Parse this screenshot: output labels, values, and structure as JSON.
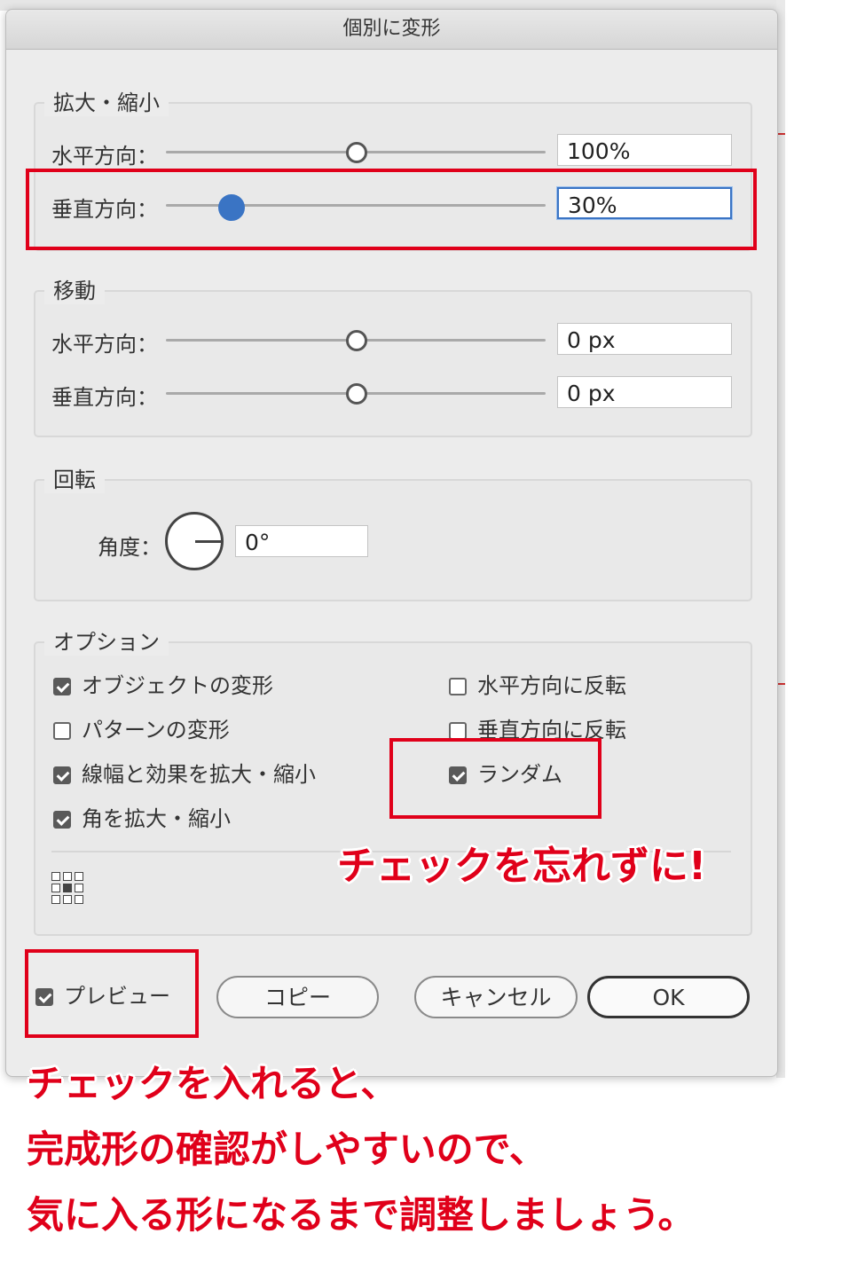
{
  "dialog": {
    "title": "個別に変形",
    "scale": {
      "legend": "拡大・縮小",
      "horizontal": {
        "label": "水平方向：",
        "value": "100%",
        "slider_level": 0.5
      },
      "vertical": {
        "label": "垂直方向：",
        "value": "30%",
        "slider_level": 0.17
      }
    },
    "move": {
      "legend": "移動",
      "horizontal": {
        "label": "水平方向：",
        "value": "0 px",
        "slider_level": 0.5
      },
      "vertical": {
        "label": "垂直方向：",
        "value": "0 px",
        "slider_level": 0.5
      }
    },
    "rotate": {
      "legend": "回転",
      "angle_label": "角度：",
      "angle_value": "0°"
    },
    "options": {
      "legend": "オプション",
      "left": [
        {
          "label": "オブジェクトの変形",
          "checked": true
        },
        {
          "label": "パターンの変形",
          "checked": false
        },
        {
          "label": "線幅と効果を拡大・縮小",
          "checked": true
        },
        {
          "label": "角を拡大・縮小",
          "checked": true
        }
      ],
      "right": [
        {
          "label": "水平方向に反転",
          "checked": false
        },
        {
          "label": "垂直方向に反転",
          "checked": false
        },
        {
          "label": "ランダム",
          "checked": true
        }
      ]
    },
    "footer": {
      "preview_label": "プレビュー",
      "preview_checked": true,
      "copy_label": "コピー",
      "cancel_label": "キャンセル",
      "ok_label": "OK"
    }
  },
  "annotations": {
    "random_note": "チェックを忘れずに!",
    "preview_note_line1": "チェックを入れると、",
    "preview_note_line2": "完成形の確認がしやすいので、",
    "preview_note_line3": "気に入る形になるまで調整しましょう。"
  },
  "colors": {
    "annotation_red": "#e0001a",
    "slider_active": "#3a74c4",
    "dialog_bg": "#ececec"
  }
}
